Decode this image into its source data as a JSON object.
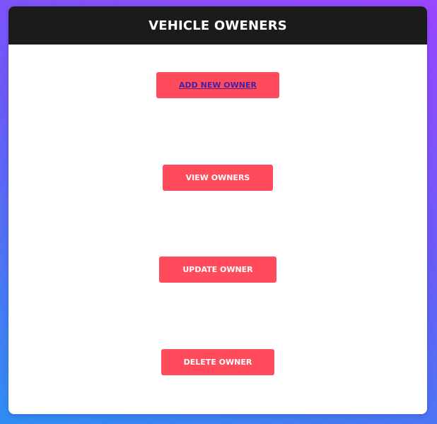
{
  "header": {
    "title": "VEHICLE OWENERS"
  },
  "actions": {
    "add_label": "ADD NEW OWNER",
    "view_label": "VIEW OWNERS",
    "update_label": "UPDATE OWNER",
    "delete_label": "DELETE OWNER"
  },
  "colors": {
    "background_gradient_top": "#9a45ff",
    "background_gradient_bottom": "#2f8df3",
    "header_bg": "#1b1b1b",
    "button_bg": "#ff4b5c",
    "link_text": "#4a1f9e"
  }
}
